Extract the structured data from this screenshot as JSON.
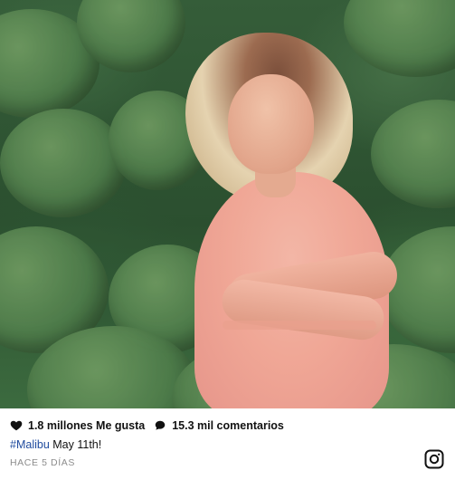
{
  "post": {
    "likes_text": "1.8 millones Me gusta",
    "comments_text": "15.3 mil comentarios",
    "caption": {
      "hashtag": "#Malibu",
      "text": " May 11th!"
    },
    "timestamp": "HACE 5 DÍAS"
  },
  "icons": {
    "likes": "heart-icon",
    "comments": "speech-bubble-icon",
    "brand": "instagram-icon"
  },
  "colors": {
    "text": "#111111",
    "hashtag": "#1f4b9e",
    "timestamp": "#8c8c8c"
  }
}
